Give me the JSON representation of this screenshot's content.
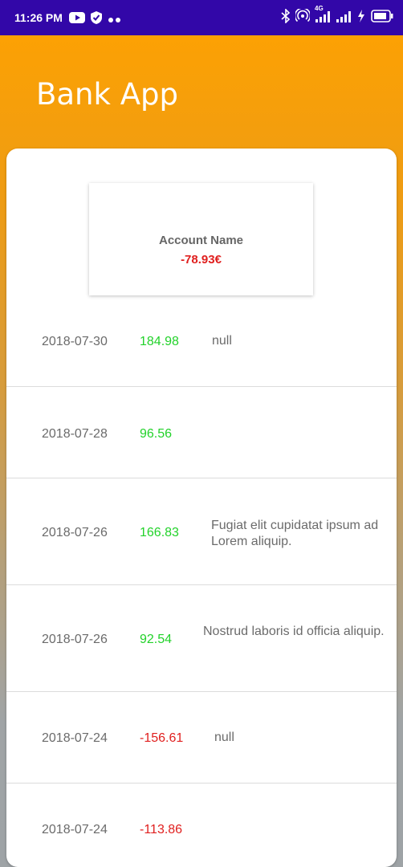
{
  "status_bar": {
    "time": "11:26 PM",
    "network": "4G",
    "icons": [
      "youtube-icon",
      "shield-icon",
      "more-dots-icon",
      "bluetooth-icon",
      "hotspot-icon",
      "signal-icon",
      "signal-icon",
      "charging-icon",
      "battery-icon"
    ]
  },
  "app_bar": {
    "title": "Bank App"
  },
  "account": {
    "name": "Account Name",
    "balance": "-78.93€"
  },
  "colors": {
    "accent": "#FFA200",
    "status_bar": "#3207A8",
    "positive": "#22D22A",
    "negative": "#E0201F"
  },
  "transactions": [
    {
      "date": "2018-07-30",
      "amount": "184.98",
      "description": "null"
    },
    {
      "date": "2018-07-28",
      "amount": "96.56",
      "description": ""
    },
    {
      "date": "2018-07-26",
      "amount": "166.83",
      "description": "Fugiat elit cupidatat ipsum ad Lorem aliquip."
    },
    {
      "date": "2018-07-26",
      "amount": "92.54",
      "description": "Nostrud laboris id officia aliquip."
    },
    {
      "date": "2018-07-24",
      "amount": "-156.61",
      "description": "null"
    },
    {
      "date": "2018-07-24",
      "amount": "-113.86",
      "description": ""
    }
  ]
}
